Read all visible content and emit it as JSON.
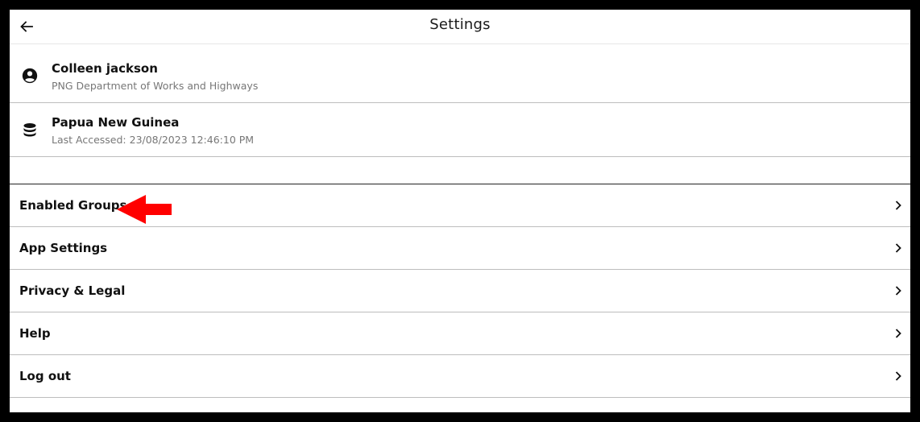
{
  "header": {
    "title": "Settings",
    "back_icon": "arrow-left-icon"
  },
  "account": {
    "name": "Colleen jackson",
    "organization": "PNG Department of Works and Highways",
    "icon": "account-circle-icon"
  },
  "database": {
    "name": "Papua New Guinea",
    "last_accessed": "Last Accessed: 23/08/2023 12:46:10 PM",
    "icon": "database-icon"
  },
  "menu": {
    "items": [
      {
        "label": "Enabled Groups"
      },
      {
        "label": "App Settings"
      },
      {
        "label": "Privacy & Legal"
      },
      {
        "label": "Help"
      },
      {
        "label": "Log out"
      }
    ]
  },
  "annotation": {
    "arrow_color": "#ff0000",
    "arrow_icon": "red-arrow-left-icon"
  },
  "colors": {
    "background": "#ffffff",
    "frame": "#000000",
    "divider": "#bdbdbd",
    "secondary_text": "#777777"
  }
}
